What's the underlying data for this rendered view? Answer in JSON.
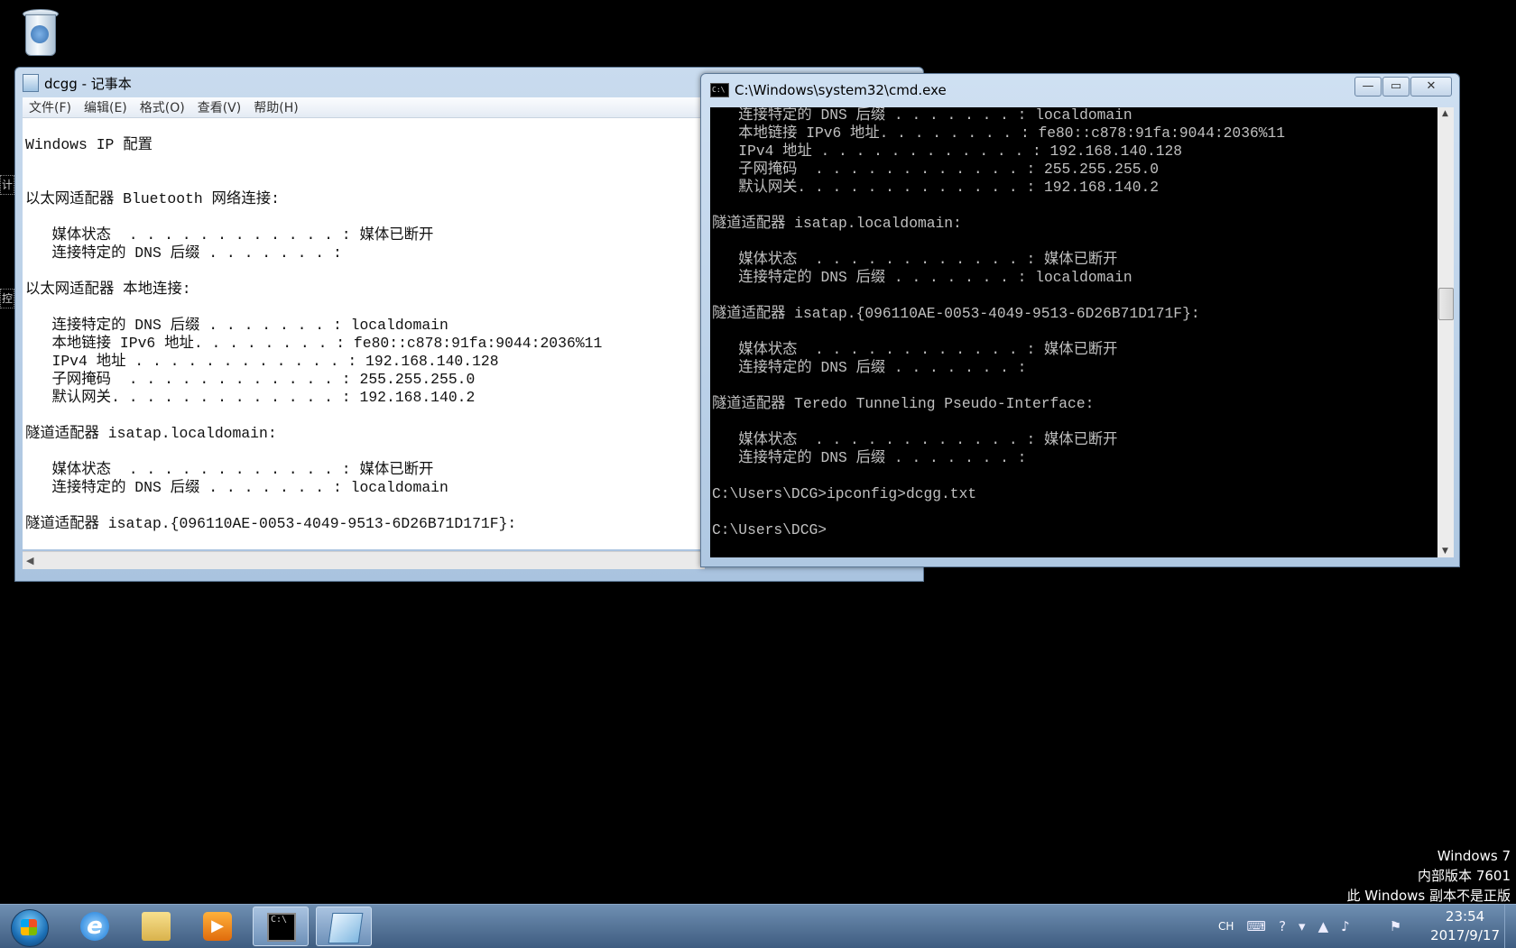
{
  "desktop": {
    "icons": [
      {
        "name": "Recycle Bin"
      }
    ],
    "left_edge_labels": [
      "计",
      "控"
    ]
  },
  "notepad": {
    "title": "dcgg - 记事本",
    "menu": [
      "文件(F)",
      "编辑(E)",
      "格式(O)",
      "查看(V)",
      "帮助(H)"
    ],
    "text": "\nWindows IP 配置\n\n\n以太网适配器 Bluetooth 网络连接:\n\n   媒体状态  . . . . . . . . . . . . : 媒体已断开\n   连接特定的 DNS 后缀 . . . . . . . :\n\n以太网适配器 本地连接:\n\n   连接特定的 DNS 后缀 . . . . . . . : localdomain\n   本地链接 IPv6 地址. . . . . . . . : fe80::c878:91fa:9044:2036%11\n   IPv4 地址 . . . . . . . . . . . . : 192.168.140.128\n   子网掩码  . . . . . . . . . . . . : 255.255.255.0\n   默认网关. . . . . . . . . . . . . : 192.168.140.2\n\n隧道适配器 isatap.localdomain:\n\n   媒体状态  . . . . . . . . . . . . : 媒体已断开\n   连接特定的 DNS 后缀 . . . . . . . : localdomain\n\n隧道适配器 isatap.{096110AE-0053-4049-9513-6D26B71D171F}:"
  },
  "cmd": {
    "title": "C:\\Windows\\system32\\cmd.exe",
    "buttons": {
      "minimize": "—",
      "maximize": "▭",
      "close": "✕"
    },
    "text": "   连接特定的 DNS 后缀 . . . . . . . : localdomain\n   本地链接 IPv6 地址. . . . . . . . : fe80::c878:91fa:9044:2036%11\n   IPv4 地址 . . . . . . . . . . . . : 192.168.140.128\n   子网掩码  . . . . . . . . . . . . : 255.255.255.0\n   默认网关. . . . . . . . . . . . . : 192.168.140.2\n\n隧道适配器 isatap.localdomain:\n\n   媒体状态  . . . . . . . . . . . . : 媒体已断开\n   连接特定的 DNS 后缀 . . . . . . . : localdomain\n\n隧道适配器 isatap.{096110AE-0053-4049-9513-6D26B71D171F}:\n\n   媒体状态  . . . . . . . . . . . . : 媒体已断开\n   连接特定的 DNS 后缀 . . . . . . . :\n\n隧道适配器 Teredo Tunneling Pseudo-Interface:\n\n   媒体状态  . . . . . . . . . . . . : 媒体已断开\n   连接特定的 DNS 后缀 . . . . . . . :\n\nC:\\Users\\DCG>ipconfig>dcgg.txt\n\nC:\\Users\\DCG>"
  },
  "watermark": {
    "line1": "Windows 7",
    "line2": "内部版本 7601",
    "line3": "此 Windows 副本不是正版"
  },
  "taskbar": {
    "apps": [
      {
        "name": "Internet Explorer",
        "icon": "ie-icon",
        "open": false
      },
      {
        "name": "Windows Explorer",
        "icon": "folder-icon",
        "open": false
      },
      {
        "name": "Windows Media Player",
        "icon": "media-player-icon",
        "open": false
      },
      {
        "name": "cmd.exe",
        "icon": "cmd-icon",
        "open": true
      },
      {
        "name": "记事本",
        "icon": "notepad-icon",
        "open": true
      }
    ],
    "tray": {
      "language": "CH"
    },
    "clock": {
      "time": "23:54",
      "date": "2017/9/17"
    }
  }
}
